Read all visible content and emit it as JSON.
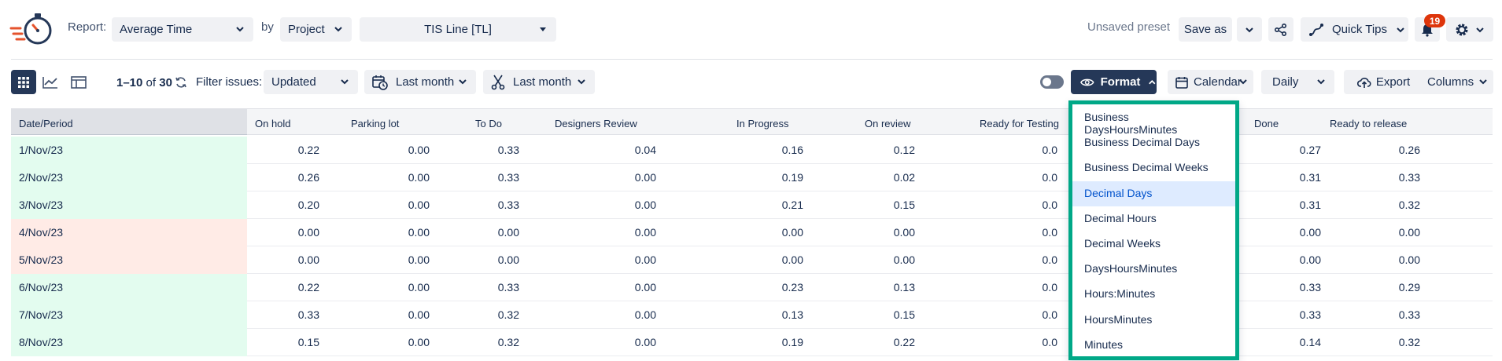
{
  "header": {
    "report_label": "Report:",
    "report_value": "Average Time",
    "by_label": "by",
    "by_value": "Project",
    "project_value": "TIS Line [TL]",
    "preset_status": "Unsaved preset",
    "save_as_label": "Save as",
    "quick_tips_label": "Quick Tips",
    "notifications_count": "19"
  },
  "toolbar": {
    "pager_range": "1–10",
    "pager_of": "of",
    "pager_total": "30",
    "filter_label": "Filter issues:",
    "filter_value": "Updated",
    "date_range_1": "Last month",
    "date_range_2": "Last month",
    "format_label": "Format",
    "calendar_label": "Calendar",
    "interval_value": "Daily",
    "export_label": "Export",
    "columns_label": "Columns"
  },
  "table": {
    "columns": [
      "Date/Period",
      "On hold",
      "Parking lot",
      "To Do",
      "Designers Review",
      "In Progress",
      "On review",
      "Ready for Testing",
      "Done",
      "Ready to release"
    ],
    "rows": [
      {
        "date": "1/Nov/23",
        "status": "good",
        "values": [
          "0.22",
          "0.00",
          "0.33",
          "0.04",
          "0.16",
          "0.12",
          "0.0",
          "0.27",
          "0.26"
        ]
      },
      {
        "date": "2/Nov/23",
        "status": "good",
        "values": [
          "0.26",
          "0.00",
          "0.33",
          "0.00",
          "0.19",
          "0.02",
          "0.0",
          "0.31",
          "0.33"
        ]
      },
      {
        "date": "3/Nov/23",
        "status": "good",
        "values": [
          "0.20",
          "0.00",
          "0.33",
          "0.00",
          "0.21",
          "0.15",
          "0.0",
          "0.31",
          "0.32"
        ]
      },
      {
        "date": "4/Nov/23",
        "status": "bad",
        "values": [
          "0.00",
          "0.00",
          "0.00",
          "0.00",
          "0.00",
          "0.00",
          "0.0",
          "0.00",
          "0.00"
        ]
      },
      {
        "date": "5/Nov/23",
        "status": "bad",
        "values": [
          "0.00",
          "0.00",
          "0.00",
          "0.00",
          "0.00",
          "0.00",
          "0.0",
          "0.00",
          "0.00"
        ]
      },
      {
        "date": "6/Nov/23",
        "status": "good",
        "values": [
          "0.22",
          "0.00",
          "0.33",
          "0.00",
          "0.23",
          "0.13",
          "0.0",
          "0.33",
          "0.29"
        ]
      },
      {
        "date": "7/Nov/23",
        "status": "good",
        "values": [
          "0.33",
          "0.00",
          "0.32",
          "0.00",
          "0.13",
          "0.15",
          "0.0",
          "0.33",
          "0.33"
        ]
      },
      {
        "date": "8/Nov/23",
        "status": "good",
        "values": [
          "0.15",
          "0.00",
          "0.32",
          "0.00",
          "0.19",
          "0.22",
          "0.0",
          "0.14",
          "0.32"
        ]
      }
    ]
  },
  "format_menu": {
    "selected": "Decimal Days",
    "options": [
      "Business DaysHoursMinutes",
      "Business Decimal Days",
      "Business Decimal Weeks",
      "Decimal Days",
      "Decimal Hours",
      "Decimal Weeks",
      "DaysHoursMinutes",
      "Hours:Minutes",
      "HoursMinutes",
      "Minutes"
    ]
  },
  "colors": {
    "primary_dark": "#253858",
    "highlight_border": "#00a887",
    "row_good": "#e3fcef",
    "row_bad": "#ffebe6",
    "badge": "#de350b",
    "selected_item": "#deebff"
  },
  "icons": [
    "stopwatch-logo-icon",
    "chevron-down-icon",
    "share-icon",
    "route-icon",
    "bell-icon",
    "gear-icon",
    "grid-icon",
    "line-chart-icon",
    "layout-icon",
    "refresh-icon",
    "calendar-clock-icon",
    "scissors-icon",
    "eye-icon",
    "chevron-up-icon",
    "calendar-icon",
    "cloud-upload-icon",
    "toggle-icon"
  ]
}
